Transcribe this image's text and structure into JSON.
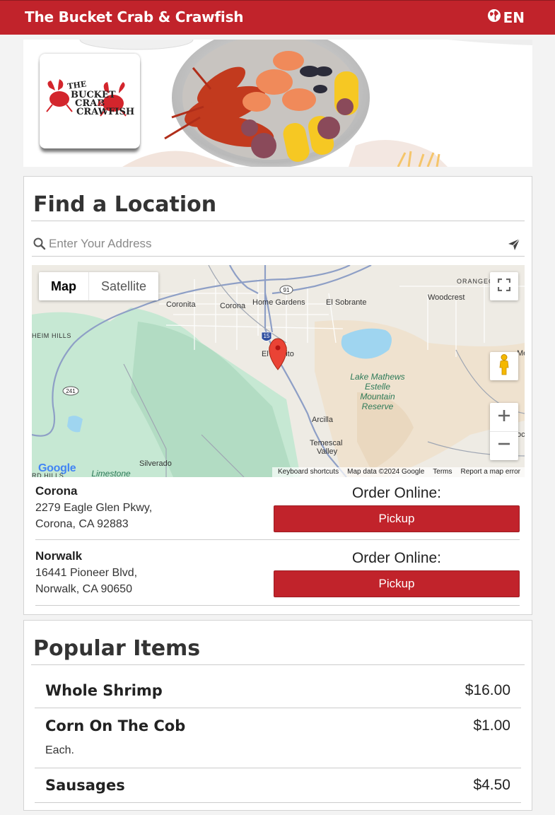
{
  "header": {
    "title": "The Bucket Crab & Crawfish",
    "language": "EN"
  },
  "locator": {
    "heading": "Find a Location",
    "search_placeholder": "Enter Your Address",
    "map": {
      "type_options": [
        "Map",
        "Satellite"
      ],
      "selected_type": "Map",
      "place_labels": [
        "ORANGECR",
        "Woodcrest",
        "Coronita",
        "Corona",
        "Home Gardens",
        "El Sobrante",
        "HEIM HILLS",
        "El Cerrito",
        "Lake Mathews",
        "Estelle",
        "Mountain",
        "Reserve",
        "Arcilla",
        "Temescal",
        "Valley",
        "Silverado",
        "Limestone",
        "RD HILLS",
        "Mead V",
        "oc"
      ],
      "route_shields": [
        "91",
        "15",
        "241"
      ],
      "footer": [
        "Keyboard shortcuts",
        "Map data ©2024 Google",
        "Terms",
        "Report a map error"
      ],
      "brand": "Google"
    },
    "stores": [
      {
        "name": "Corona",
        "address_line1": "2279 Eagle Glen Pkwy,",
        "address_line2": "Corona, CA 92883",
        "order_label": "Order Online:",
        "button": "Pickup"
      },
      {
        "name": "Norwalk",
        "address_line1": "16441 Pioneer Blvd,",
        "address_line2": "Norwalk, CA 90650",
        "order_label": "Order Online:",
        "button": "Pickup"
      }
    ]
  },
  "popular": {
    "heading": "Popular Items",
    "items": [
      {
        "name": "Whole Shrimp",
        "price": "$16.00",
        "description": ""
      },
      {
        "name": "Corn On The Cob",
        "price": "$1.00",
        "description": "Each."
      },
      {
        "name": "Sausages",
        "price": "$4.50",
        "description": ""
      }
    ]
  },
  "colors": {
    "brand_red": "#c1232b",
    "map_water": "#9fd5f0",
    "map_park": "#c6e8d3"
  }
}
